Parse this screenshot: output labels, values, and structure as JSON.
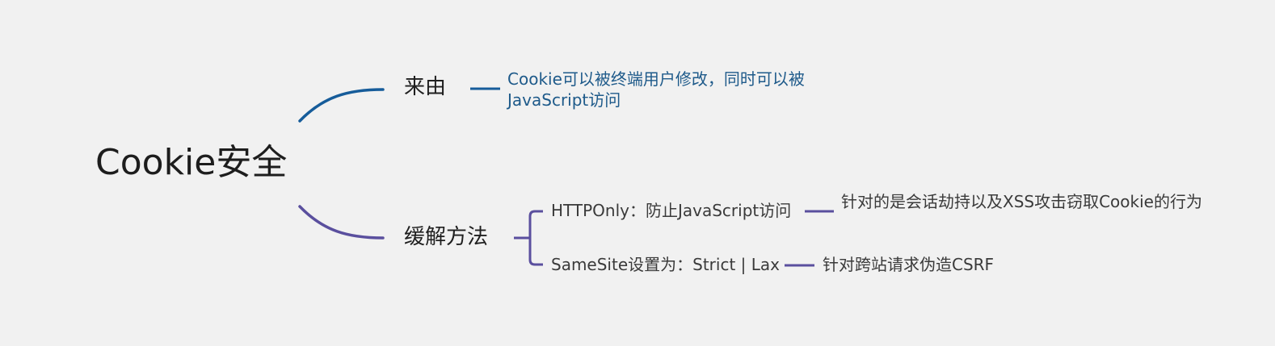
{
  "mindmap": {
    "root": "Cookie安全",
    "branch_origin": {
      "label": "来由",
      "detail": "Cookie可以被终端用户修改，同时可以被JavaScript访问"
    },
    "branch_mitigation": {
      "label": "缓解方法",
      "children": [
        {
          "label": "HTTPOnly：防止JavaScript访问",
          "detail": "针对的是会话劫持以及XSS攻击窃取Cookie的行为"
        },
        {
          "label": "SameSite设置为：Strict | Lax",
          "detail": "针对跨站请求伪造CSRF"
        }
      ]
    }
  },
  "colors": {
    "background": "#f1f1f1",
    "branch_origin": "#165c9a",
    "branch_mitigation": "#5a4f9e",
    "detail_origin_text": "#1e5a8a"
  }
}
